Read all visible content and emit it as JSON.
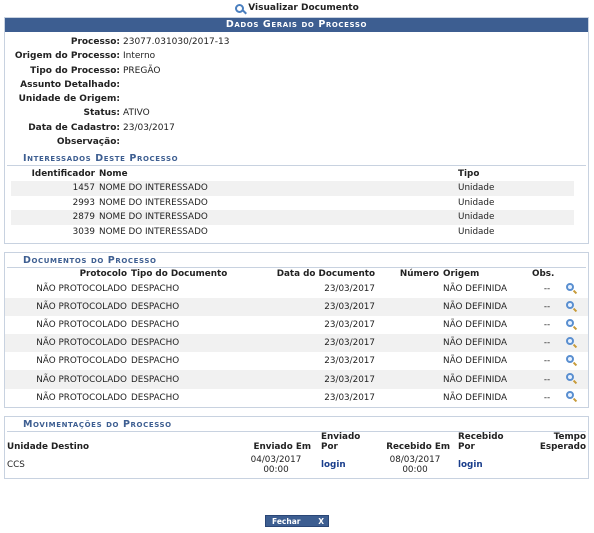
{
  "top_link": "Visualizar Documento",
  "dados": {
    "caption": "Dados Gerais do Processo",
    "fields": [
      {
        "label": "Processo:",
        "value": "23077.031030/2017-13"
      },
      {
        "label": "Origem do Processo:",
        "value": "Interno"
      },
      {
        "label": "Tipo do Processo:",
        "value": "PREGÃO"
      },
      {
        "label": "Assunto Detalhado:",
        "value": ""
      },
      {
        "label": "Unidade de Origem:",
        "value": ""
      },
      {
        "label": "Status:",
        "value": "ATIVO"
      },
      {
        "label": "Data de Cadastro:",
        "value": "23/03/2017"
      },
      {
        "label": "Observação:",
        "value": ""
      }
    ]
  },
  "interessados": {
    "caption": "Interessados Deste Processo",
    "headers": [
      "Identificador",
      "Nome",
      "Tipo"
    ],
    "rows": [
      [
        "1457",
        "NOME DO INTERESSADO",
        "Unidade"
      ],
      [
        "2993",
        "NOME DO INTERESSADO",
        "Unidade"
      ],
      [
        "2879",
        "NOME DO INTERESSADO",
        "Unidade"
      ],
      [
        "3039",
        "NOME DO INTERESSADO",
        "Unidade"
      ]
    ]
  },
  "documentos": {
    "caption": "Documentos do Processo",
    "headers": [
      "Protocolo",
      "Tipo do Documento",
      "Data do Documento",
      "Número",
      "Origem",
      "Obs."
    ],
    "rows": [
      [
        "NÃO PROTOCOLADO",
        "DESPACHO",
        "23/03/2017",
        "",
        "NÃO DEFINIDA",
        "--"
      ],
      [
        "NÃO PROTOCOLADO",
        "DESPACHO",
        "23/03/2017",
        "",
        "NÃO DEFINIDA",
        "--"
      ],
      [
        "NÃO PROTOCOLADO",
        "DESPACHO",
        "23/03/2017",
        "",
        "NÃO DEFINIDA",
        "--"
      ],
      [
        "NÃO PROTOCOLADO",
        "DESPACHO",
        "23/03/2017",
        "",
        "NÃO DEFINIDA",
        "--"
      ],
      [
        "NÃO PROTOCOLADO",
        "DESPACHO",
        "23/03/2017",
        "",
        "NÃO DEFINIDA",
        "--"
      ],
      [
        "NÃO PROTOCOLADO",
        "DESPACHO",
        "23/03/2017",
        "",
        "NÃO DEFINIDA",
        "--"
      ],
      [
        "NÃO PROTOCOLADO",
        "DESPACHO",
        "23/03/2017",
        "",
        "NÃO DEFINIDA",
        "--"
      ]
    ]
  },
  "movimentacoes": {
    "caption": "Movimentações do Processo",
    "headers": {
      "unidade": "Unidade Destino",
      "enviado_em": "Enviado Em",
      "enviado_por_1": "Enviado",
      "enviado_por_2": "Por",
      "recebido_em": "Recebido Em",
      "recebido_por_1": "Recebido",
      "recebido_por_2": "Por",
      "tempo_1": "Tempo",
      "tempo_2": "Esperado"
    },
    "row": {
      "unidade": "CCS",
      "enviado_em_1": "04/03/2017",
      "enviado_em_2": "00:00",
      "enviado_por": "login",
      "recebido_em_1": "08/03/2017",
      "recebido_em_2": "00:00",
      "recebido_por": "login",
      "tempo": ""
    }
  },
  "close_button": {
    "label": "Fechar",
    "x": "X"
  }
}
